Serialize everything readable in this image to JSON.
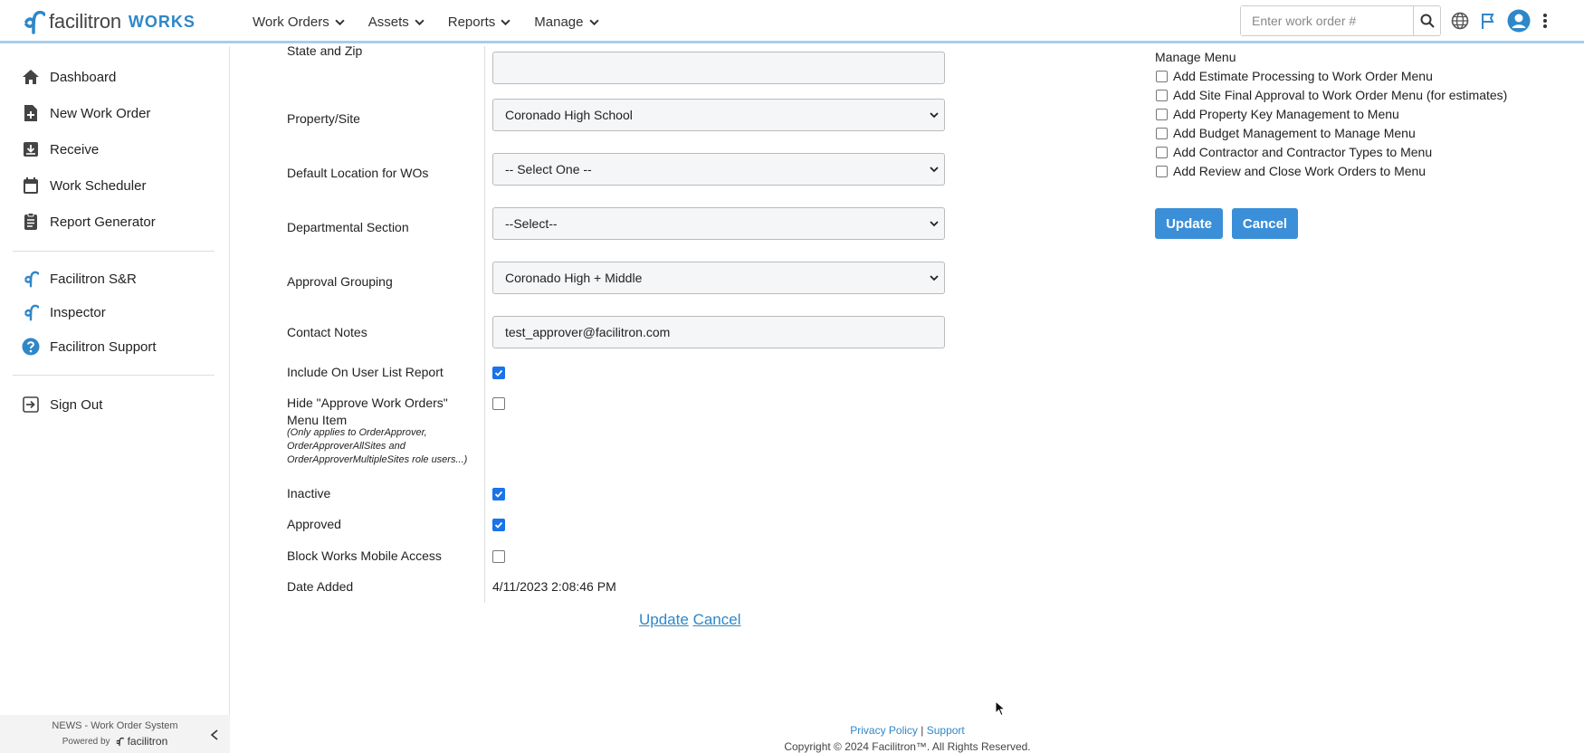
{
  "header": {
    "logo_text": "facilitron",
    "logo_sub": "WORKS",
    "nav": [
      "Work Orders",
      "Assets",
      "Reports",
      "Manage"
    ],
    "search_placeholder": "Enter work order #"
  },
  "sidebar": {
    "items": [
      "Dashboard",
      "New Work Order",
      "Receive",
      "Work Scheduler",
      "Report Generator"
    ],
    "apps": [
      "Facilitron S&R",
      "Inspector",
      "Facilitron Support"
    ],
    "signout": "Sign Out",
    "footer": "NEWS - Work Order System",
    "powered": "Powered by",
    "powered_brand": "facilitron"
  },
  "form": {
    "state_zip_label": "State and Zip",
    "property_label": "Property/Site",
    "property_value": "Coronado High School",
    "location_label": "Default Location for WOs",
    "location_value": "-- Select One --",
    "section_label": "Departmental Section",
    "section_value": "--Select--",
    "approval_label": "Approval Grouping",
    "approval_value": "Coronado High + Middle",
    "notes_label": "Contact Notes",
    "notes_value": "test_approver@facilitron.com",
    "userlist_label": "Include On User List Report",
    "hide_label": "Hide \"Approve Work Orders\" Menu Item",
    "hide_note": "(Only applies to OrderApprover, OrderApproverAllSites and OrderApproverMultipleSites role users...)",
    "inactive_label": "Inactive",
    "approved_label": "Approved",
    "block_label": "Block Works Mobile Access",
    "date_label": "Date Added",
    "date_value": "4/11/2023 2:08:46 PM",
    "update_link": "Update",
    "cancel_link": "Cancel"
  },
  "manage_menu": {
    "title": "Manage Menu",
    "items": [
      "Add Estimate Processing to Work Order Menu",
      "Add Site Final Approval to Work Order Menu (for estimates)",
      "Add Property Key Management to Menu",
      "Add Budget Management to Manage Menu",
      "Add Contractor and Contractor Types to Menu",
      "Add Review and Close Work Orders to Menu"
    ],
    "update_btn": "Update",
    "cancel_btn": "Cancel"
  },
  "footer": {
    "privacy": "Privacy Policy",
    "sep": "|",
    "support": "Support",
    "copyright": "Copyright © 2024 Facilitron™. All Rights Reserved."
  },
  "colors": {
    "accent": "#2f87c8",
    "button": "#3b8fd8",
    "checkbox_on": "#1a73e8"
  }
}
